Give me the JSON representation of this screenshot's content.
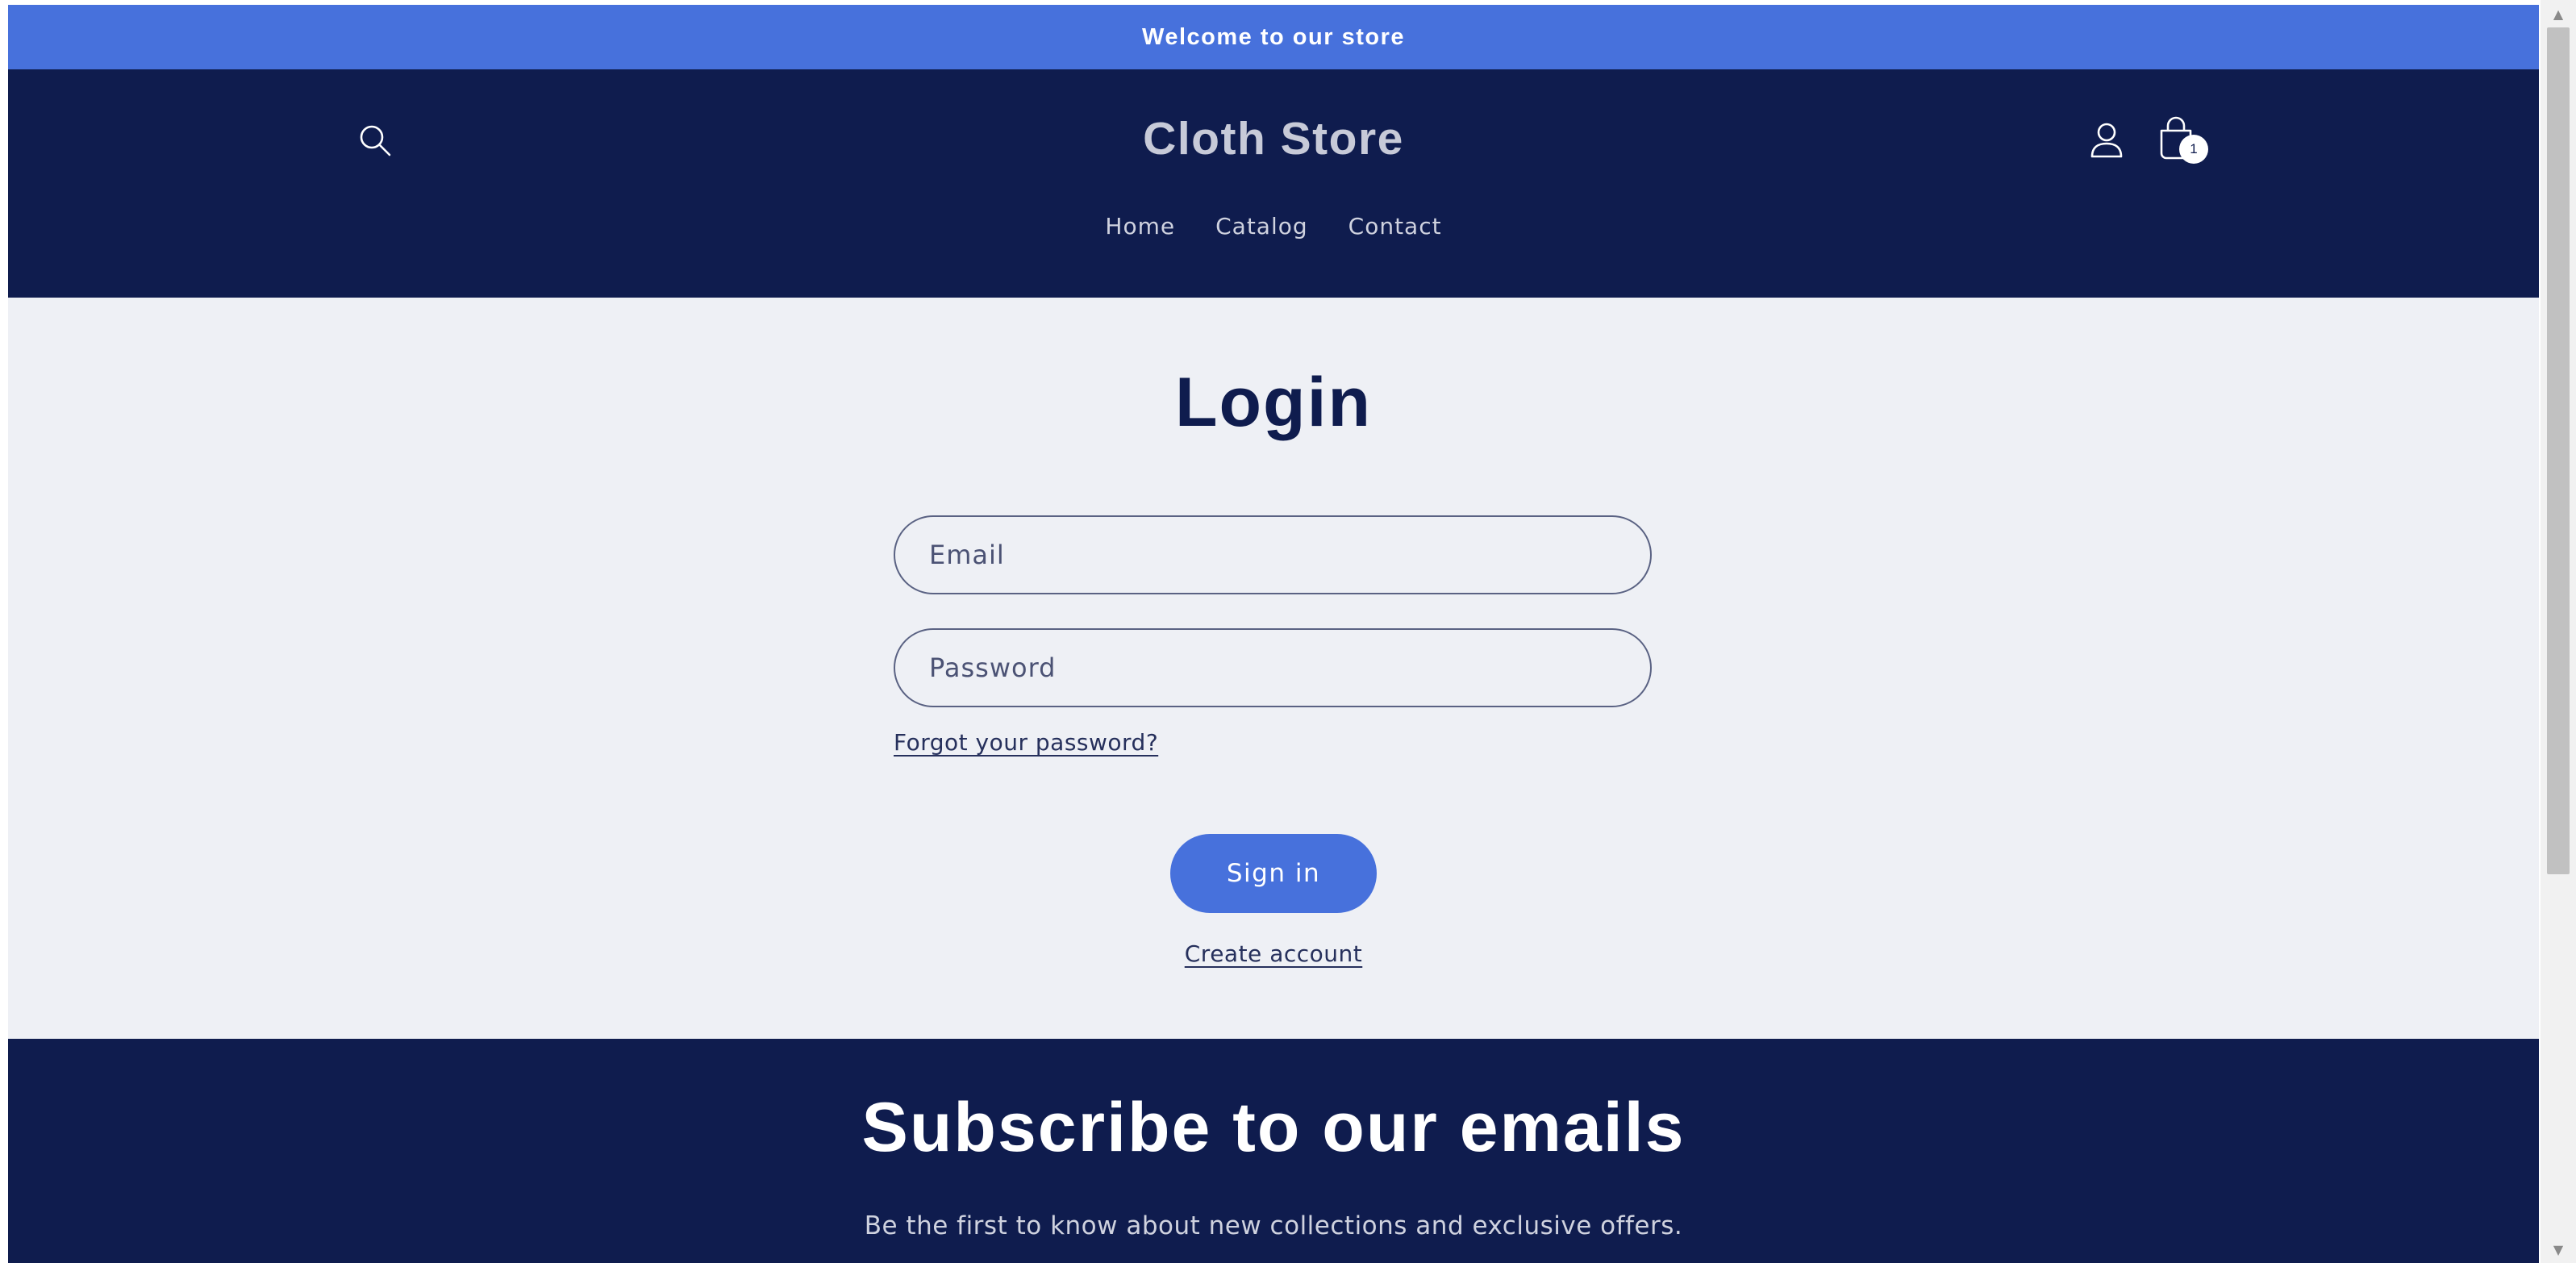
{
  "announcement": {
    "text": "Welcome to our store"
  },
  "header": {
    "store_name": "Cloth Store",
    "search_icon": "search-icon",
    "account_icon": "user-icon",
    "cart_icon": "shopping-bag-icon",
    "cart_count": "1",
    "nav": [
      {
        "label": "Home"
      },
      {
        "label": "Catalog"
      },
      {
        "label": "Contact"
      }
    ]
  },
  "login": {
    "title": "Login",
    "email_placeholder": "Email",
    "password_placeholder": "Password",
    "forgot_label": "Forgot your password?",
    "signin_label": "Sign in",
    "create_account_label": "Create account"
  },
  "newsletter": {
    "title": "Subscribe to our emails",
    "text": "Be the first to know about new collections and exclusive offers."
  },
  "colors": {
    "accent": "#4771dc",
    "header_bg": "#0f1c4e",
    "page_bg": "#eef0f5"
  }
}
